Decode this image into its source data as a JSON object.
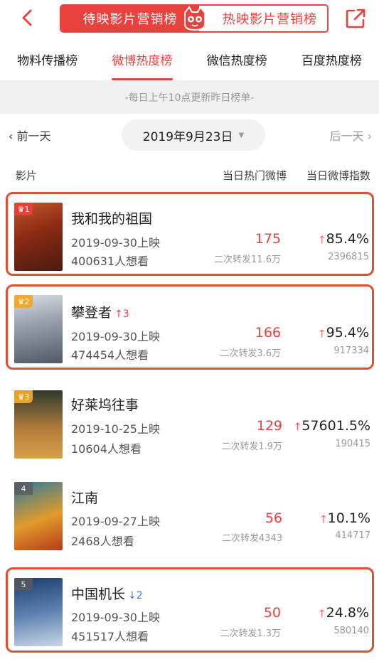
{
  "nav": {
    "segment_left": "待映影片营销榜",
    "segment_right": "热映影片营销榜"
  },
  "tabs": [
    "物料传播榜",
    "微博热度榜",
    "微信热度榜",
    "百度热度榜"
  ],
  "active_tab": 1,
  "notice": "-每日上午10点更新昨日榜单-",
  "datebar": {
    "prev": "前一天",
    "date": "2019年9月23日",
    "next": "后一天"
  },
  "columns": {
    "film": "影片",
    "hot_weibo": "当日热门微博",
    "weibo_index": "当日微博指数"
  },
  "colors": {
    "accent": "#e8413e",
    "highlight_box": "#e1502e",
    "rank_gold": "#f2a727",
    "down_arrow": "#3e79d6"
  },
  "films": [
    {
      "rank": "1",
      "title": "我和我的祖国",
      "change": "",
      "release": "2019-09-30上映",
      "want": "400631人想看",
      "hot": "175",
      "repost": "二次转发11.6万",
      "pct": "85.4%",
      "index": "2396815"
    },
    {
      "rank": "2",
      "title": "攀登者",
      "change": "3",
      "release": "2019-09-30上映",
      "want": "474454人想看",
      "hot": "166",
      "repost": "二次转发3.6万",
      "pct": "95.4%",
      "index": "917334"
    },
    {
      "rank": "3",
      "title": "好莱坞往事",
      "change": "",
      "release": "2019-10-25上映",
      "want": "10604人想看",
      "hot": "129",
      "repost": "二次转发1.9万",
      "pct": "57601.5%",
      "index": "190415"
    },
    {
      "rank": "4",
      "title": "江南",
      "change": "",
      "release": "2019-09-27上映",
      "want": "2468人想看",
      "hot": "56",
      "repost": "二次转发4343",
      "pct": "10.1%",
      "index": "414717"
    },
    {
      "rank": "5",
      "title": "中国机长",
      "change": "2",
      "release": "2019-09-30上映",
      "want": "451517人想看",
      "hot": "50",
      "repost": "二次转发1.3万",
      "pct": "24.8%",
      "index": "580140"
    }
  ]
}
